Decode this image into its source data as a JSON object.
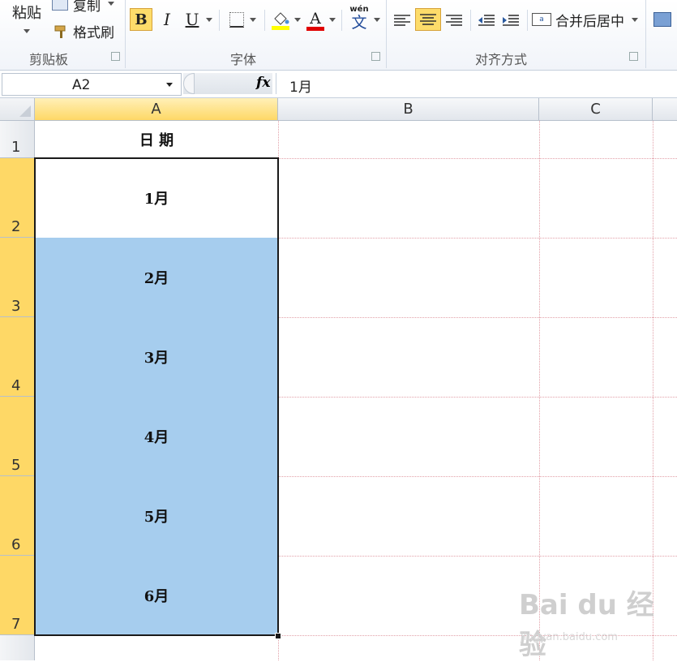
{
  "ribbon": {
    "clipboard": {
      "paste_label": "粘贴",
      "copy_label": "复制",
      "format_painter_label": "格式刷",
      "group_label": "剪贴板"
    },
    "font": {
      "bold_label": "B",
      "italic_label": "I",
      "underline_label": "U",
      "font_color_label": "A",
      "phonetic_label": "wén",
      "phonetic_char": "文",
      "group_label": "字体"
    },
    "alignment": {
      "merge_center_label": "合并后居中",
      "group_label": "对齐方式"
    }
  },
  "formula_bar": {
    "name_box": "A2",
    "fx_label": "fx",
    "content": "1月"
  },
  "sheet": {
    "columns": [
      "A",
      "B",
      "C"
    ],
    "rows": [
      "1",
      "2",
      "3",
      "4",
      "5",
      "6",
      "7"
    ],
    "cells": {
      "A1": "日 期",
      "A2": "1月",
      "A3": "2月",
      "A4": "3月",
      "A5": "4月",
      "A6": "5月",
      "A7": "6月"
    }
  },
  "colors": {
    "selection_fill": "#a6cdee",
    "header_highlight": "#fed866",
    "font_color_bar": "#e00000",
    "fill_color_bar": "#ffff00",
    "active_align_bg": "#fddc6a"
  },
  "watermark": {
    "brand": "Bai du 经验",
    "url": "jingyan.baidu.com"
  }
}
